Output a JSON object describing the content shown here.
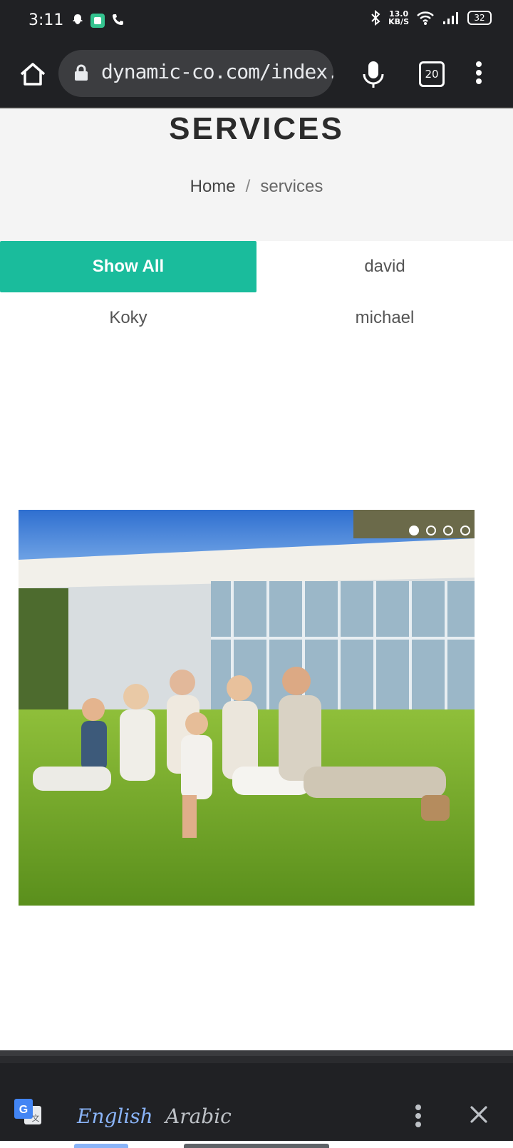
{
  "status_bar": {
    "time": "3:11",
    "speed_value": "13.0",
    "speed_unit": "KB/S",
    "battery": "32"
  },
  "browser": {
    "url": "dynamic-co.com/index.php/Se",
    "tab_count": "20"
  },
  "page": {
    "title": "SERVICES",
    "breadcrumb": {
      "home": "Home",
      "separator": "/",
      "current": "services"
    },
    "filters": [
      "Show All",
      "david",
      "Koky",
      "michael"
    ],
    "active_filter_color": "#1abc9c",
    "slider": {
      "image": "family-on-lawn-photo",
      "page_count": 4,
      "active_page": 1
    }
  },
  "translate_bar": {
    "languages": [
      "English",
      "Arabic"
    ],
    "active_language": "English",
    "accent": "#8ab4f8"
  }
}
